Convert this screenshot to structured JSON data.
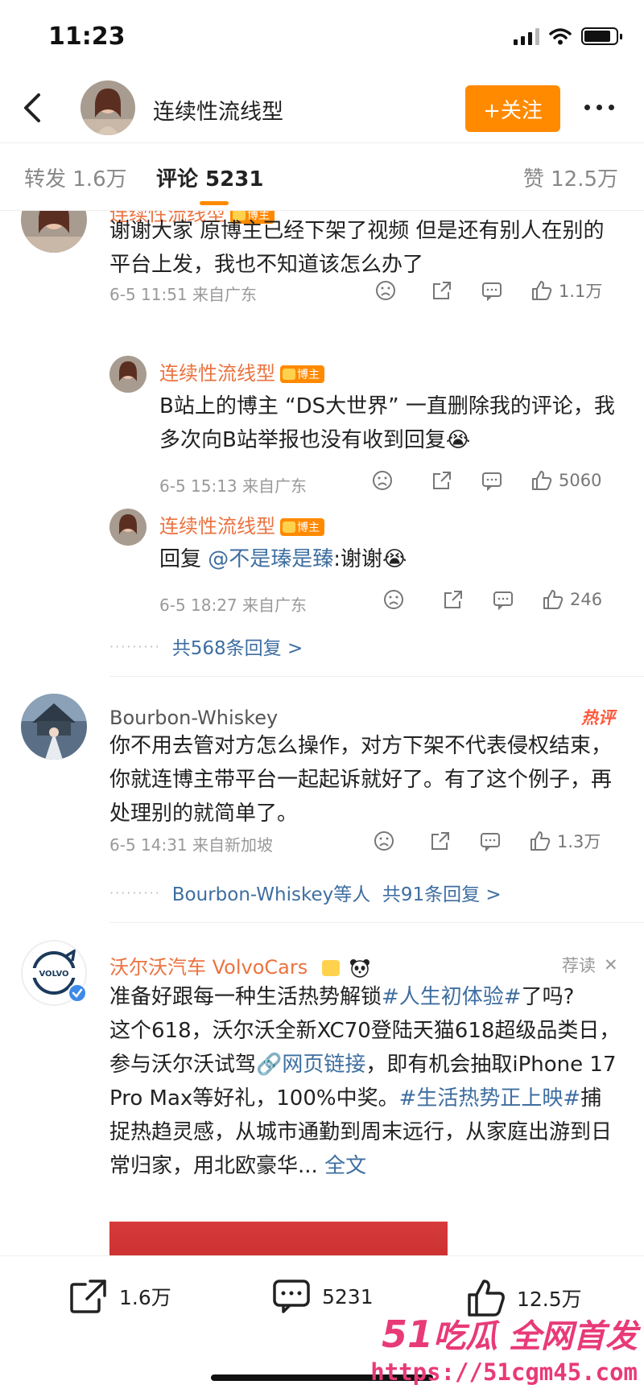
{
  "status_bar": {
    "time": "11:23",
    "battery_level": 0.85
  },
  "header": {
    "title": "连续性流线型",
    "follow_label": "+关注",
    "avatar": "user-avatar"
  },
  "tabs": [
    {
      "label": "转发 1.6万"
    },
    {
      "label": "评论 5231",
      "active": true
    },
    {
      "label": "赞 12.5万"
    }
  ],
  "comments": [
    {
      "name": "连续性流线型",
      "badge": "博主",
      "text": "谢谢大家 原博主已经下架了视频 但是还有别人在别的平台上发，我也不知道该怎么办了",
      "meta": "6-5 11:51 来自广东",
      "likes": "1.1万",
      "replies": [
        {
          "name": "连续性流线型",
          "badge": "博主",
          "text": "B站上的博主 “DS大世界” 一直删除我的评论，我多次向B站举报也没有收到回复😭",
          "meta": "6-5 15:13 来自广东",
          "likes": "5060"
        },
        {
          "name": "连续性流线型",
          "badge": "博主",
          "text_prefix": "回复",
          "mention": "@不是瑧是臻",
          "text_suffix": ":谢谢😭",
          "meta": "6-5 18:27 来自广东",
          "likes": "246"
        }
      ],
      "more_replies": "共568条回复 >"
    },
    {
      "name": "Bourbon-Whiskey",
      "hot_tag": "热评",
      "text": "你不用去管对方怎么操作，对方下架不代表侵权结束，你就连博主带平台一起起诉就好了。有了这个例子，再处理别的就简单了。",
      "meta": "6-5 14:31 来自新加坡",
      "likes": "1.3万",
      "more_replies_prefix": "Bourbon-Whiskey等人",
      "more_replies": "共91条回复 >"
    }
  ],
  "ad": {
    "name": "沃尔沃汽车 VolvoCars",
    "tag": "荐读",
    "close": "✕",
    "logo_text": "VOLVO",
    "body": [
      {
        "t": "准备好跟每一种生活热势解锁"
      },
      {
        "t": "#人生初体验#",
        "link": true
      },
      {
        "t": "了吗?\n这个618，沃尔沃全新XC70登陆天猫618超级品类日，参与沃尔沃试驾"
      },
      {
        "t": "🔗网页链接",
        "link": true
      },
      {
        "t": "，即有机会抽取iPhone 17 Pro Max等好礼，100%中奖。"
      },
      {
        "t": "#生活热势正上映#",
        "link": true
      },
      {
        "t": "捕捉热趋灵感，从城市通勤到周末远行，从家庭出游到日常归家，用北欧豪华... "
      },
      {
        "t": "全文",
        "link": true
      }
    ]
  },
  "bottom_bar": {
    "reposts": "1.6万",
    "comments": "5231",
    "likes": "12.5万"
  },
  "watermark": {
    "line1_num": "51",
    "line1_text": "吃瓜 全网首发",
    "line2": "https://51cgm45.com"
  }
}
